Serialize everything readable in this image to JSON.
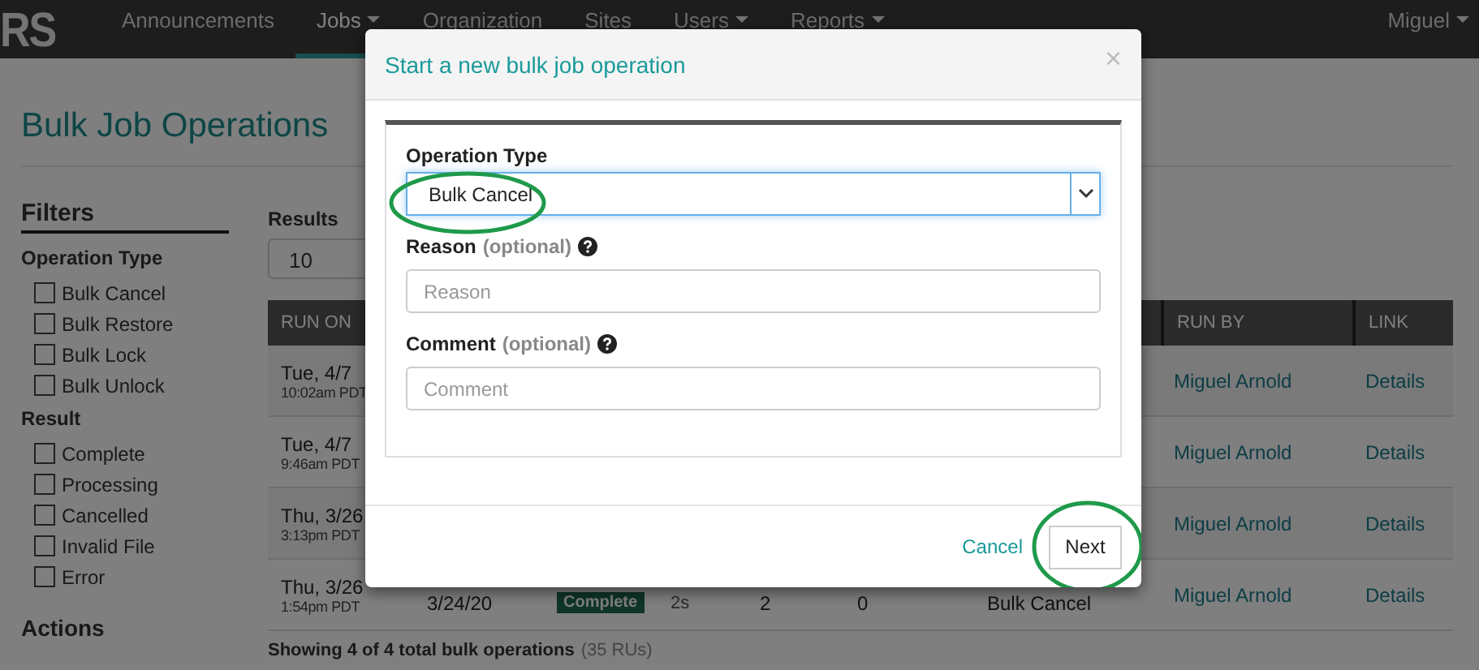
{
  "navbar": {
    "logo": "RS",
    "items": [
      {
        "label": "Announcements",
        "selected": false,
        "dropdown": false
      },
      {
        "label": "Jobs",
        "selected": true,
        "dropdown": true
      },
      {
        "label": "Organization",
        "selected": false,
        "dropdown": false
      },
      {
        "label": "Sites",
        "selected": false,
        "dropdown": false
      },
      {
        "label": "Users",
        "selected": false,
        "dropdown": true
      },
      {
        "label": "Reports",
        "selected": false,
        "dropdown": true
      }
    ],
    "user": {
      "label": "Miguel",
      "dropdown": true
    }
  },
  "page_title": "Bulk Job Operations",
  "filters": {
    "title": "Filters",
    "groups": [
      {
        "title": "Operation Type",
        "options": [
          {
            "label": "Bulk Cancel",
            "checked": false
          },
          {
            "label": "Bulk Restore",
            "checked": false
          },
          {
            "label": "Bulk Lock",
            "checked": false
          },
          {
            "label": "Bulk Unlock",
            "checked": false
          }
        ]
      },
      {
        "title": "Result",
        "options": [
          {
            "label": "Complete",
            "checked": false
          },
          {
            "label": "Processing",
            "checked": false
          },
          {
            "label": "Cancelled",
            "checked": false
          },
          {
            "label": "Invalid File",
            "checked": false
          },
          {
            "label": "Error",
            "checked": false
          }
        ]
      }
    ],
    "actions_title": "Actions"
  },
  "results": {
    "label": "Results",
    "value": "10"
  },
  "table": {
    "columns": [
      "RUN ON",
      "RUN BY",
      "LINK"
    ],
    "rows": [
      {
        "date": "Tue, 4/7",
        "time": "10:02am PDT",
        "run_by": "Miguel Arnold",
        "link": "Details"
      },
      {
        "date": "Tue, 4/7",
        "time": "9:46am PDT",
        "run_by": "Miguel Arnold",
        "link": "Details"
      },
      {
        "date": "Thu, 3/26",
        "time": "3:13pm PDT",
        "run_by": "Miguel Arnold",
        "link": "Details"
      },
      {
        "date": "Thu, 3/26",
        "time": "1:54pm PDT",
        "run_by": "Miguel Arnold",
        "link": "Details",
        "cells": [
          {
            "kind": "text",
            "text": "3/24/20"
          },
          {
            "kind": "badge",
            "text": "Complete"
          },
          {
            "kind": "small",
            "text": "2s"
          },
          {
            "kind": "text",
            "text": "2"
          },
          {
            "kind": "text",
            "text": "0"
          },
          {
            "kind": "text",
            "text": "Bulk Cancel"
          }
        ]
      }
    ]
  },
  "summary": {
    "text": "Showing 4 of 4 total bulk operations",
    "note": "(35 RUs)"
  },
  "modal": {
    "title": "Start a new bulk job operation",
    "close": "×",
    "operation_type": {
      "label": "Operation Type",
      "value": "Bulk Cancel"
    },
    "fields": [
      {
        "label": "Reason",
        "hint": "(optional)",
        "placeholder": "Reason"
      },
      {
        "label": "Comment",
        "hint": "(optional)",
        "placeholder": "Comment"
      }
    ],
    "buttons": [
      {
        "kind": "link",
        "label": "Cancel"
      },
      {
        "kind": "button",
        "label": "Next"
      }
    ]
  }
}
